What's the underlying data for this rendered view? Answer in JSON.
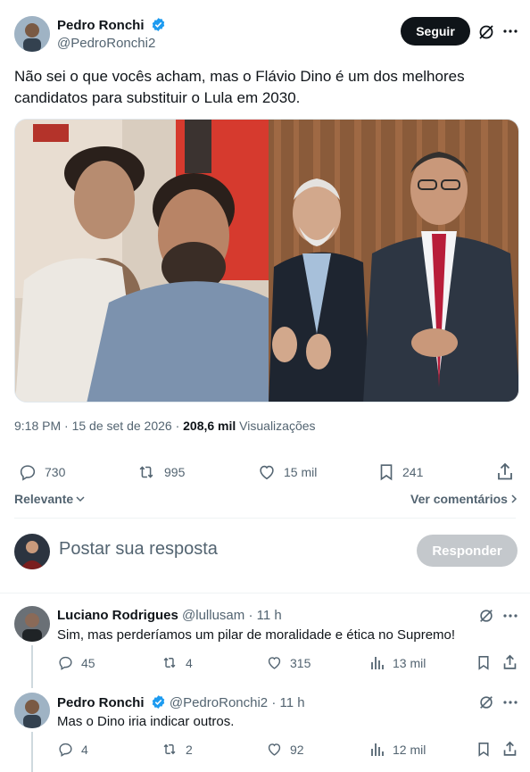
{
  "tweet": {
    "author_name": "Pedro Ronchi",
    "author_handle": "@PedroRonchi2",
    "follow_label": "Seguir",
    "text_line1": "Não sei o que vocês acham, mas o Flávio Dino é um dos melhores",
    "text_line2": "candidatos para substituir o Lula em 2030.",
    "time": "9:18 PM · 15 de set de 2026 · ",
    "views_count": "208,6 mil",
    "views_label": "Visualizações",
    "stats": {
      "replies": "730",
      "reposts": "995",
      "likes": "15 mil",
      "bookmarks": "241"
    }
  },
  "sort": {
    "label": "Relevante",
    "see_comments": "Ver comentários"
  },
  "reply_box": {
    "placeholder": "Postar sua resposta",
    "button": "Responder"
  },
  "replies": [
    {
      "name": "Luciano Rodrigues",
      "handle": "@lullusam",
      "time": "· 11 h",
      "text": "Sim, mas perderíamos um pilar de moralidade e ética no Supremo!",
      "replies": "45",
      "reposts": "4",
      "likes": "315",
      "views": "13 mil"
    },
    {
      "name": "Pedro Ronchi",
      "handle": "@PedroRonchi2",
      "time": "· 11 h",
      "text": "Mas o Dino iria indicar outros.",
      "replies": "4",
      "reposts": "2",
      "likes": "92",
      "views": "12 mil"
    }
  ],
  "colors": {
    "verified": "#1d9bf0",
    "follow_bg": "#0f1419",
    "reply_btn_disabled": "#c4c8cc"
  }
}
